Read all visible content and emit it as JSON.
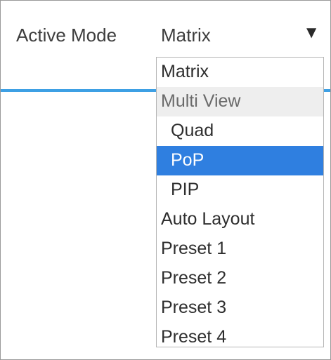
{
  "field": {
    "label": "Active Mode",
    "selected_value": "Matrix",
    "arrow": "▼"
  },
  "dropdown": {
    "options": [
      {
        "label": "Matrix",
        "kind": "option"
      },
      {
        "label": "Multi View",
        "kind": "group"
      },
      {
        "label": "Quad",
        "kind": "sub"
      },
      {
        "label": "PoP",
        "kind": "sub-selected"
      },
      {
        "label": "PIP",
        "kind": "sub"
      },
      {
        "label": "Auto Layout",
        "kind": "option"
      },
      {
        "label": "Preset 1",
        "kind": "option"
      },
      {
        "label": "Preset 2",
        "kind": "option"
      },
      {
        "label": "Preset 3",
        "kind": "option"
      },
      {
        "label": "Preset 4",
        "kind": "option"
      }
    ]
  },
  "colors": {
    "accent_line": "#3ea0e4",
    "highlight": "#2f7fe0",
    "group_bg": "#eeeeee"
  }
}
